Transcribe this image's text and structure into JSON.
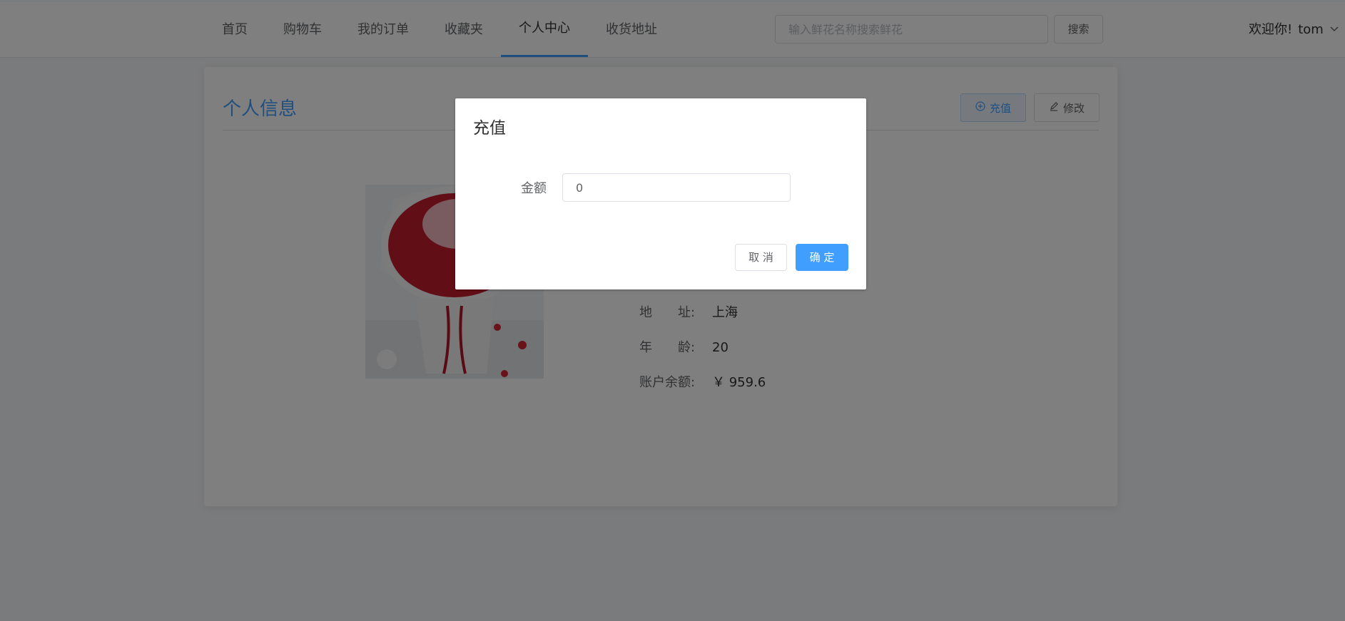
{
  "nav": {
    "items": [
      {
        "label": "首页"
      },
      {
        "label": "购物车"
      },
      {
        "label": "我的订单"
      },
      {
        "label": "收藏夹"
      },
      {
        "label": "个人中心"
      },
      {
        "label": "收货地址"
      }
    ],
    "active_item": "个人中心"
  },
  "search": {
    "placeholder": "输入鲜花名称搜索鲜花",
    "button_label": "搜索"
  },
  "user_menu": {
    "greeting": "欢迎你!",
    "username": "tom",
    "icon": "chevron-down-icon"
  },
  "profile": {
    "title": "个人信息",
    "recharge_label": "充值",
    "edit_label": "修改",
    "avatar_alt": "red-rose-bouquet-photo",
    "fields": [
      {
        "label": "地　　址:",
        "value": "上海"
      },
      {
        "label": "年　　龄:",
        "value": "20"
      },
      {
        "label": "账户余额:",
        "value": "￥ 959.6"
      }
    ]
  },
  "dialog": {
    "title": "充值",
    "amount_label": "金额",
    "amount_value": "0",
    "cancel_label": "取 消",
    "confirm_label": "确 定"
  },
  "colors": {
    "primary": "#409eff",
    "overlay": "rgba(0,0,0,0.5)",
    "text": "#303133",
    "muted": "#606266"
  }
}
